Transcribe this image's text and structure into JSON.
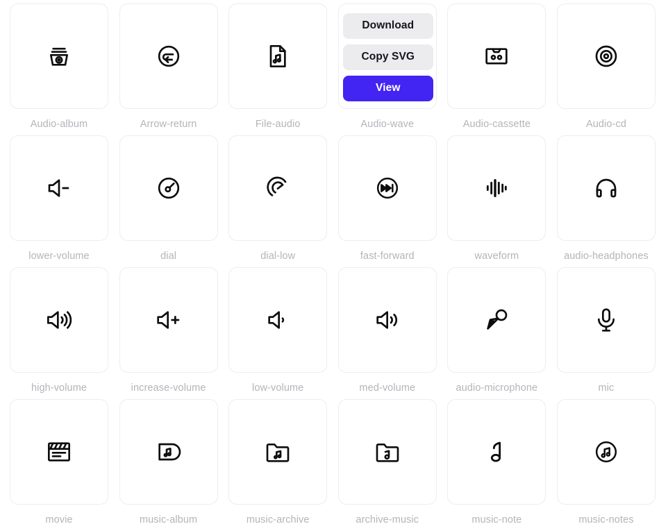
{
  "theme": {
    "page_background": "#ffffff",
    "card_border": "#ededf0",
    "icon_color": "#0d0d0f",
    "label_color": "#b4b4ba",
    "button_secondary_bg": "#ececee",
    "button_secondary_text": "#15151a",
    "button_primary_bg": "#4225f2",
    "button_primary_text": "#ffffff"
  },
  "hover_overlay": {
    "active_index": 3,
    "download_label": "Download",
    "copy_svg_label": "Copy SVG",
    "view_label": "View"
  },
  "grid": {
    "columns": 6,
    "rows": 4,
    "items": [
      {
        "label": "Audio-album",
        "icon": "audio-album-icon"
      },
      {
        "label": "Arrow-return",
        "icon": "arrow-return-icon"
      },
      {
        "label": "File-audio",
        "icon": "file-audio-icon"
      },
      {
        "label": "Audio-wave",
        "icon": "audio-wave-icon"
      },
      {
        "label": "Audio-cassette",
        "icon": "audio-cassette-icon"
      },
      {
        "label": "Audio-cd",
        "icon": "audio-cd-icon"
      },
      {
        "label": "lower-volume",
        "icon": "lower-volume-icon"
      },
      {
        "label": "dial",
        "icon": "dial-icon"
      },
      {
        "label": "dial-low",
        "icon": "dial-low-icon"
      },
      {
        "label": "fast-forward",
        "icon": "fast-forward-icon"
      },
      {
        "label": "waveform",
        "icon": "waveform-icon"
      },
      {
        "label": "audio-headphones",
        "icon": "audio-headphones-icon"
      },
      {
        "label": "high-volume",
        "icon": "high-volume-icon"
      },
      {
        "label": "increase-volume",
        "icon": "increase-volume-icon"
      },
      {
        "label": "low-volume",
        "icon": "low-volume-icon"
      },
      {
        "label": "med-volume",
        "icon": "med-volume-icon"
      },
      {
        "label": "audio-microphone",
        "icon": "audio-microphone-icon"
      },
      {
        "label": "mic",
        "icon": "mic-icon"
      },
      {
        "label": "movie",
        "icon": "movie-icon"
      },
      {
        "label": "music-album",
        "icon": "music-album-icon"
      },
      {
        "label": "music-archive",
        "icon": "music-archive-icon"
      },
      {
        "label": "archive-music",
        "icon": "archive-music-icon"
      },
      {
        "label": "music-note",
        "icon": "music-note-icon"
      },
      {
        "label": "music-notes",
        "icon": "music-notes-icon"
      }
    ]
  }
}
